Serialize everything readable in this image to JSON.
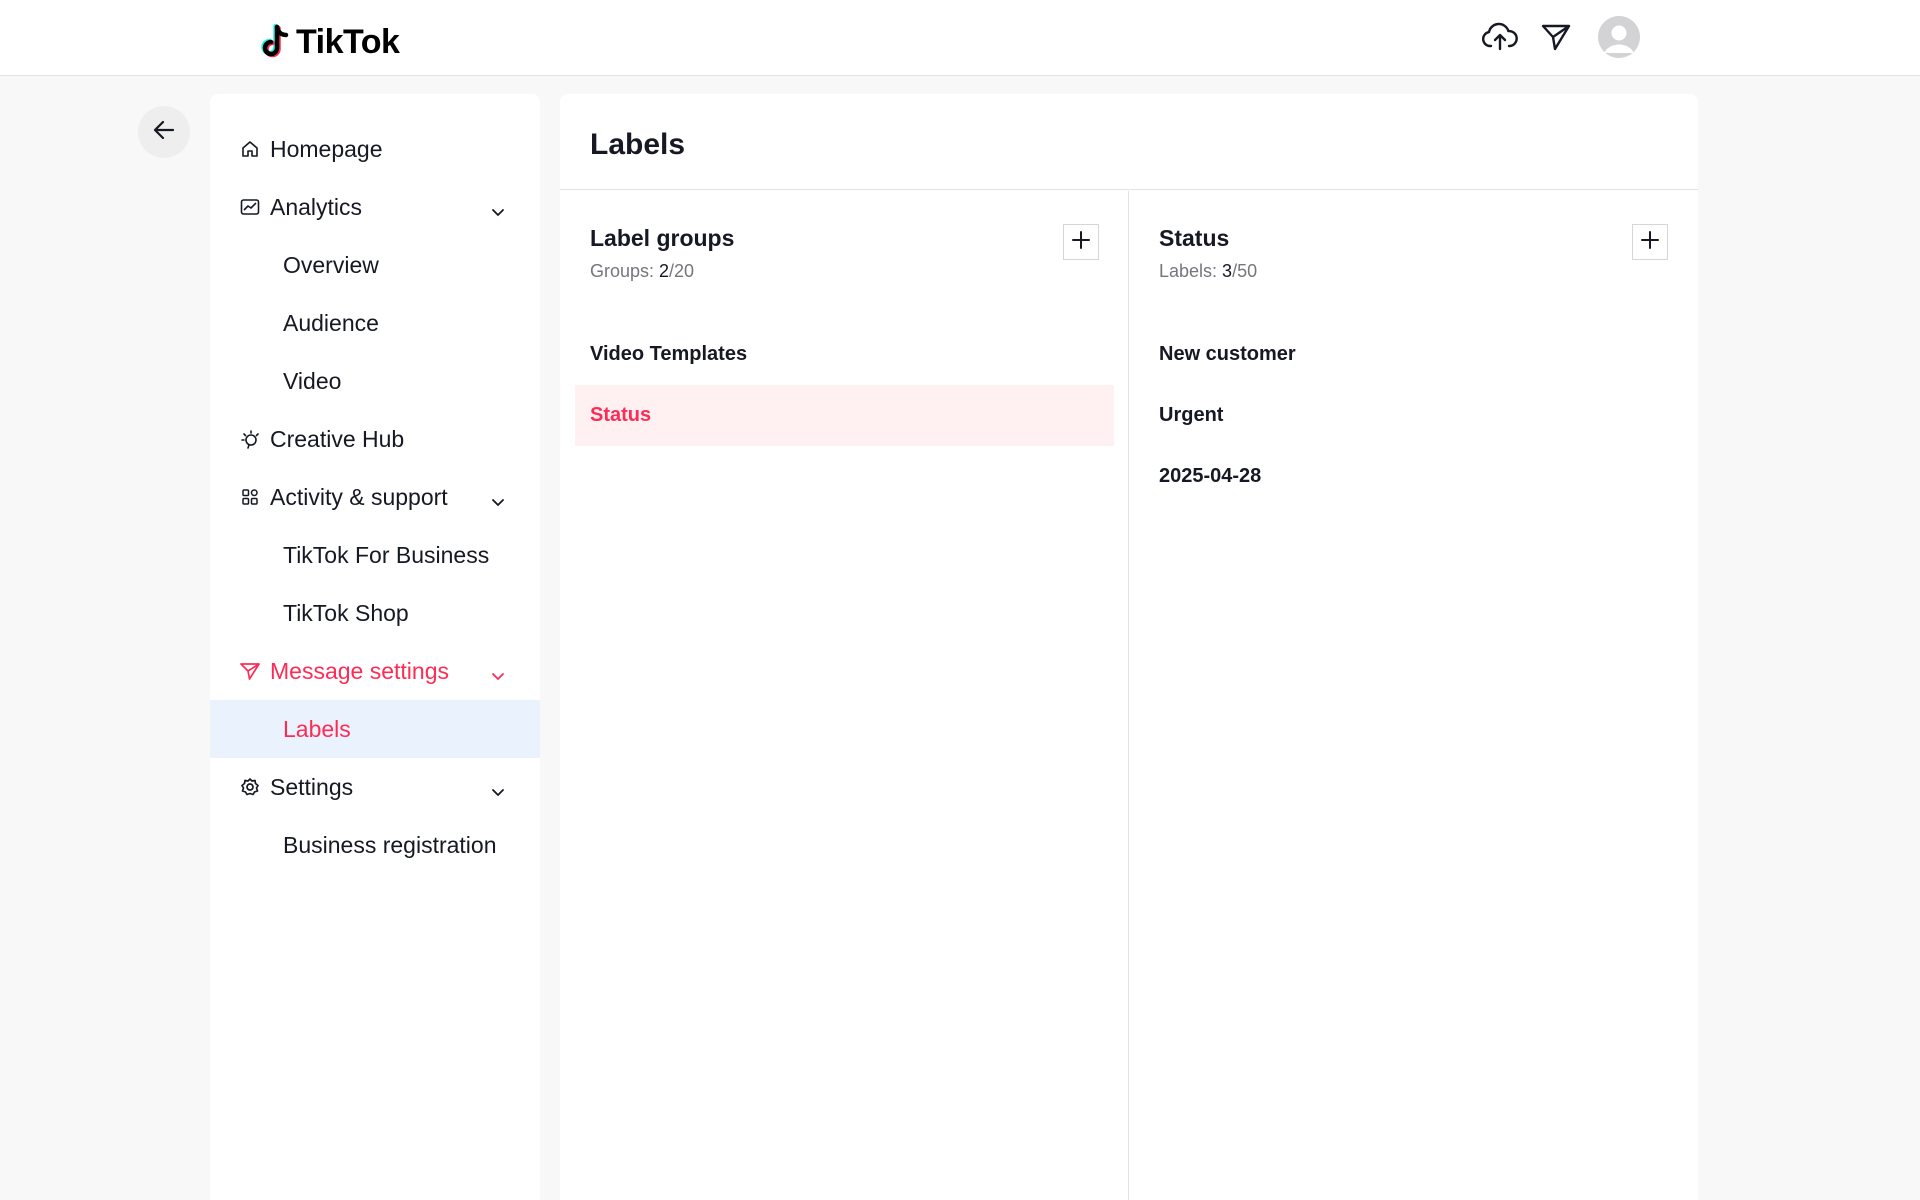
{
  "header": {
    "brand": "TikTok",
    "icons": [
      "upload-icon",
      "send-icon",
      "avatar"
    ]
  },
  "sidebar": {
    "items": [
      {
        "label": "Homepage",
        "icon": "home-icon"
      },
      {
        "label": "Analytics",
        "icon": "analytics-icon",
        "expanded": true
      },
      {
        "label": "Overview"
      },
      {
        "label": "Audience"
      },
      {
        "label": "Video"
      },
      {
        "label": "Creative Hub",
        "icon": "lightbulb-icon"
      },
      {
        "label": "Activity & support",
        "icon": "apps-icon",
        "expanded": true
      },
      {
        "label": "TikTok For Business"
      },
      {
        "label": "TikTok Shop"
      },
      {
        "label": "Message settings",
        "icon": "send-icon",
        "expanded": true
      },
      {
        "label": "Labels"
      },
      {
        "label": "Settings",
        "icon": "gear-icon",
        "expanded": true
      },
      {
        "label": "Business registration"
      }
    ]
  },
  "main": {
    "title": "Labels",
    "groups": {
      "title": "Label groups",
      "count_prefix": "Groups: ",
      "count": "2",
      "count_suffix": "/20",
      "items": [
        "Video Templates",
        "Status"
      ]
    },
    "labels": {
      "title": "Status",
      "count_prefix": "Labels: ",
      "count": "3",
      "count_suffix": "/50",
      "items": [
        "New customer",
        "Urgent",
        "2025-04-28"
      ]
    }
  },
  "colors": {
    "accent": "#fe2c55",
    "selected_nav_bg": "#eaf2fd",
    "selected_row_bg": "#fff0f2"
  }
}
